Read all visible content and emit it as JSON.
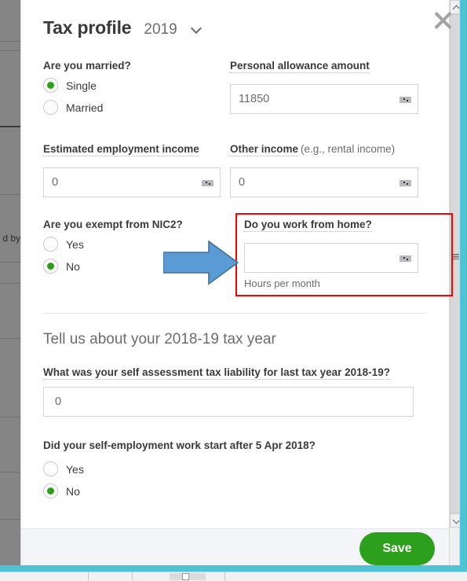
{
  "window": {
    "close_icon": "close-icon",
    "scrollbar": {
      "up_icon": "chevron-up-icon",
      "down_icon": "chevron-down-icon"
    }
  },
  "modal": {
    "title": "Tax profile",
    "year": {
      "value": "2019",
      "chevron_icon": "chevron-down-icon"
    },
    "sections": {
      "profile": {
        "married": {
          "label": "Are you married?",
          "options": [
            {
              "label": "Single",
              "selected": true
            },
            {
              "label": "Married",
              "selected": false
            }
          ]
        },
        "personal_allowance": {
          "label": "Personal allowance amount",
          "value": "11850",
          "stepper_icon": "stepper-icon"
        },
        "employment_income": {
          "label": "Estimated employment income",
          "value": "0",
          "stepper_icon": "stepper-icon"
        },
        "other_income": {
          "label": "Other income",
          "label_sub": "(e.g., rental income)",
          "value": "0",
          "stepper_icon": "stepper-icon"
        },
        "nic2_exempt": {
          "label": "Are you exempt from NIC2?",
          "options": [
            {
              "label": "Yes",
              "selected": false
            },
            {
              "label": "No",
              "selected": true
            }
          ]
        },
        "work_from_home": {
          "label": "Do you work from home?",
          "value": "",
          "helper": "Hours per month",
          "stepper_icon": "stepper-icon",
          "highlight_color": "#ff0000"
        }
      },
      "tax_year": {
        "heading": "Tell us about your 2018-19 tax year",
        "liability": {
          "label": "What was your self assessment tax liability for last tax year 2018-19?",
          "value": "0"
        },
        "start_after": {
          "label": "Did your self-employment work start after 5 Apr 2018?",
          "options": [
            {
              "label": "Yes",
              "selected": false
            },
            {
              "label": "No",
              "selected": true
            }
          ]
        }
      }
    },
    "footer": {
      "save_label": "Save"
    }
  },
  "annotations": {
    "arrow": {
      "name": "blue-arrow-annotation",
      "fill": "#5b9bd5",
      "stroke": "#41719c"
    }
  },
  "background": {
    "text_fragment": "d by",
    "accent_color": "#4ec3d6"
  }
}
